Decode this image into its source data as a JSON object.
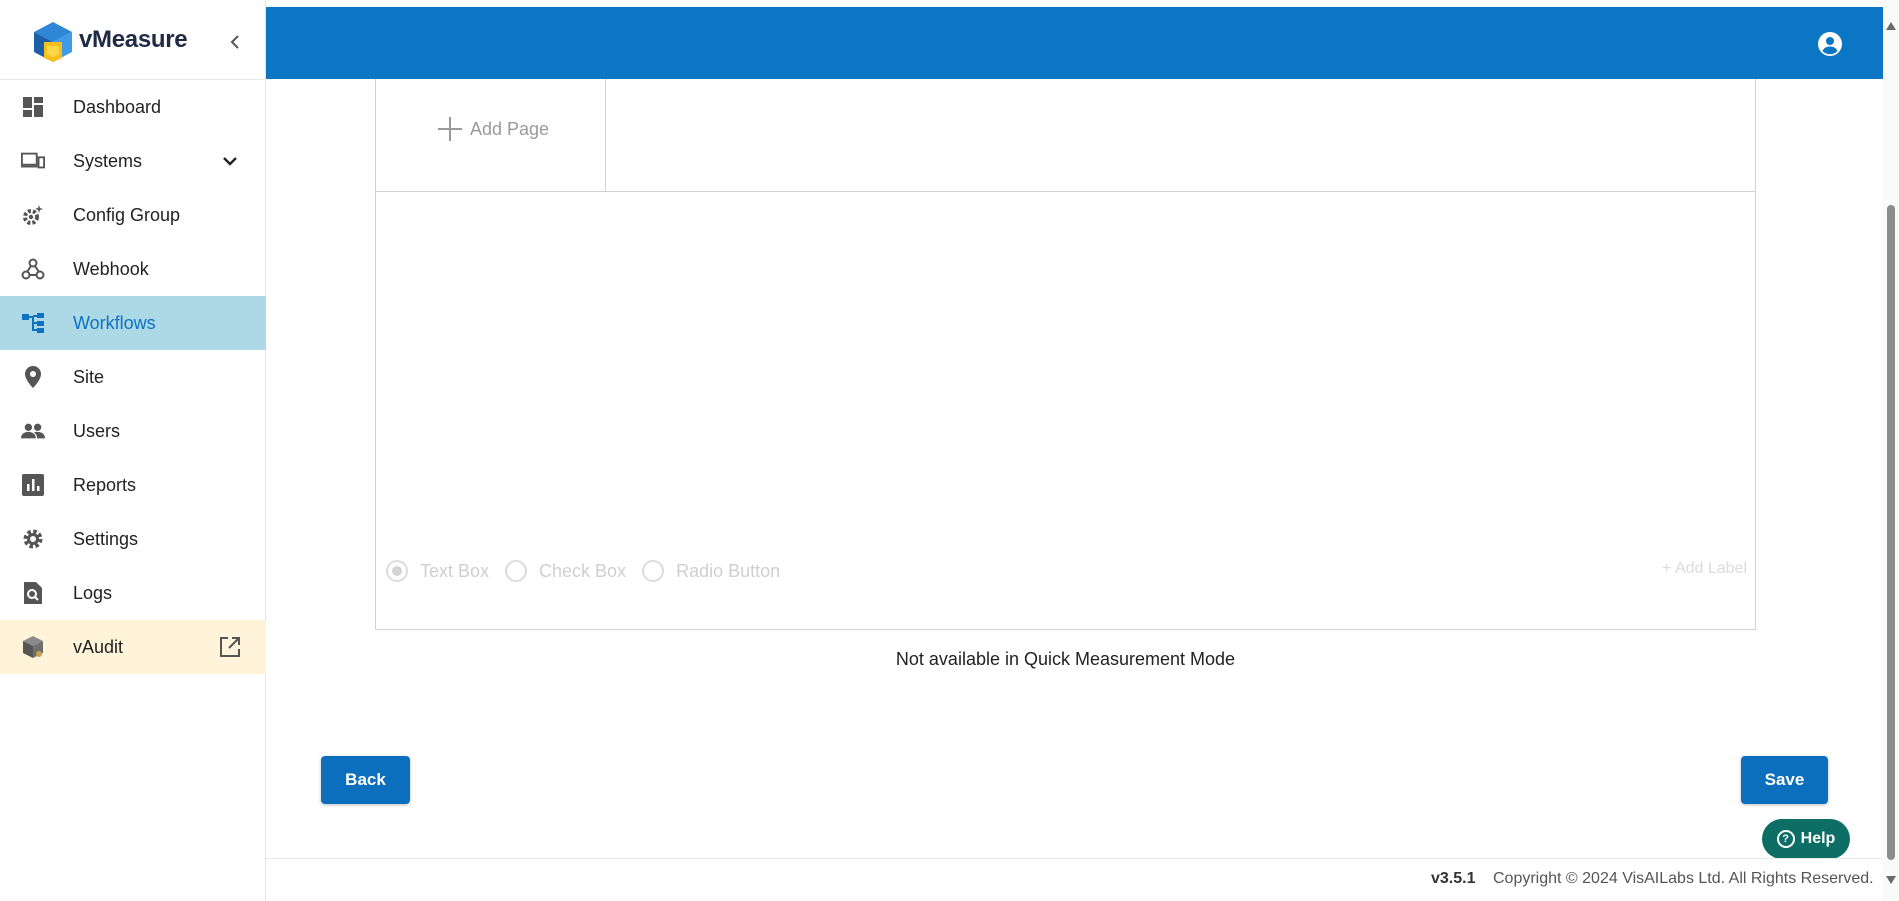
{
  "app": {
    "name": "vMeasure"
  },
  "sidebar": {
    "items": [
      {
        "label": "Dashboard"
      },
      {
        "label": "Systems"
      },
      {
        "label": "Config Group"
      },
      {
        "label": "Webhook"
      },
      {
        "label": "Workflows"
      },
      {
        "label": "Site"
      },
      {
        "label": "Users"
      },
      {
        "label": "Reports"
      },
      {
        "label": "Settings"
      },
      {
        "label": "Logs"
      },
      {
        "label": "vAudit"
      }
    ]
  },
  "builder": {
    "add_page_label": "Add Page",
    "field_types": [
      "Text Box",
      "Check Box",
      "Radio Button"
    ],
    "add_label": "+ Add Label"
  },
  "notice": "Not available in Quick Measurement Mode",
  "actions": {
    "back_label": "Back",
    "save_label": "Save",
    "help_label": "Help"
  },
  "footer": {
    "version": "v3.5.1",
    "copyright": "Copyright © 2024 VisAILabs Ltd. All Rights Reserved."
  },
  "colors": {
    "primary": "#0b76c4",
    "active_bg": "#add8e6",
    "audit_bg": "#fff4d9",
    "help": "#0c6e64"
  }
}
